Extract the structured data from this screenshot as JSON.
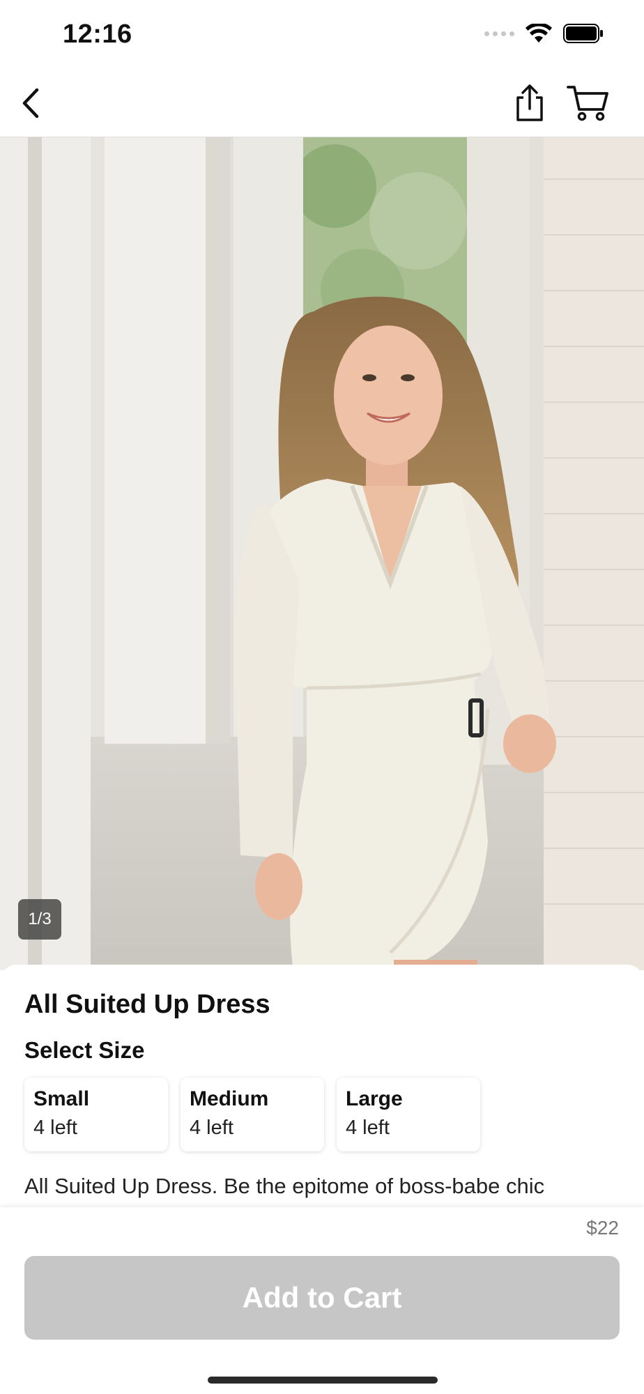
{
  "status_bar": {
    "time": "12:16",
    "icons": [
      "cellular-signal-icon",
      "wifi-icon",
      "battery-icon"
    ]
  },
  "nav": {
    "back_icon": "chevron-left-icon",
    "share_icon": "share-icon",
    "cart_icon": "cart-icon"
  },
  "gallery": {
    "counter": "1/3"
  },
  "product": {
    "title": "All Suited Up Dress",
    "size_heading": "Select Size",
    "sizes": [
      {
        "name": "Small",
        "stock": "4 left"
      },
      {
        "name": "Medium",
        "stock": "4 left"
      },
      {
        "name": "Large",
        "stock": "4 left"
      }
    ],
    "description": "All Suited Up Dress. Be the epitome of boss-babe chic"
  },
  "purchase": {
    "price": "$22",
    "add_to_cart_label": "Add to Cart"
  },
  "colors": {
    "disabled_button": "#c6c6c6",
    "price_text": "#777777"
  }
}
